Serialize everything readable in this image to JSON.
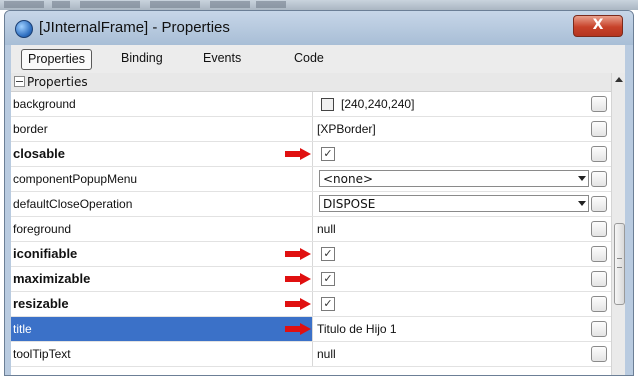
{
  "window": {
    "title": "[JInternalFrame] - Properties",
    "close_label": "X"
  },
  "tabs": [
    {
      "label": "Properties",
      "active": true
    },
    {
      "label": "Binding",
      "active": false
    },
    {
      "label": "Events",
      "active": false
    },
    {
      "label": "Code",
      "active": false
    }
  ],
  "section": {
    "label": "Properties"
  },
  "properties": [
    {
      "name": "background",
      "value": "[240,240,240]",
      "bold": false
    },
    {
      "name": "border",
      "value": "[XPBorder]",
      "bold": false
    },
    {
      "name": "closable",
      "value": "✓",
      "bold": true
    },
    {
      "name": "componentPopupMenu",
      "value": "<none>",
      "bold": false
    },
    {
      "name": "defaultCloseOperation",
      "value": "DISPOSE",
      "bold": false
    },
    {
      "name": "foreground",
      "value": "null",
      "bold": false
    },
    {
      "name": "iconifiable",
      "value": "✓",
      "bold": true
    },
    {
      "name": "maximizable",
      "value": "✓",
      "bold": true
    },
    {
      "name": "resizable",
      "value": "✓",
      "bold": true
    },
    {
      "name": "title",
      "value": "Titulo de Hijo 1",
      "bold": false,
      "selected": true
    },
    {
      "name": "toolTipText",
      "value": "null",
      "bold": false
    }
  ],
  "colors": {
    "selection": "#3b71c8",
    "marker_arrow": "#e01010",
    "close_button": "#c7422a"
  },
  "icons": {
    "app": "app-icon",
    "arrow": "red-arrow-icon",
    "ellipsis": "ellipsis-icon",
    "dropdown": "chevron-down-icon"
  }
}
